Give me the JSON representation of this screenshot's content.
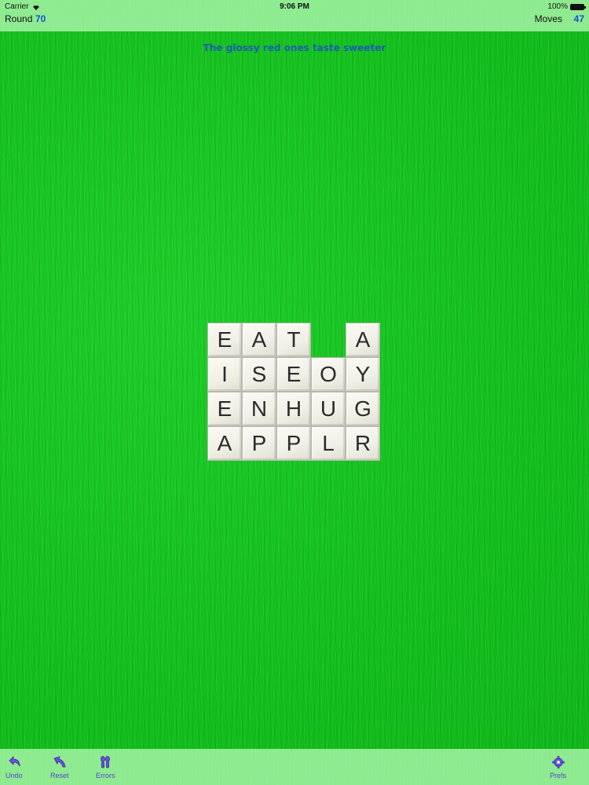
{
  "status_bar": {
    "carrier": "Carrier",
    "time": "9:06 PM",
    "battery": "100%"
  },
  "header": {
    "round_label": "Round",
    "round_value": "70",
    "moves_label": "Moves",
    "moves_value": "47"
  },
  "hint": "The glossy red ones taste sweeter",
  "board": {
    "rows": [
      [
        "E",
        "A",
        "T",
        "",
        "A"
      ],
      [
        "I",
        "S",
        "E",
        "O",
        "Y"
      ],
      [
        "E",
        "N",
        "H",
        "U",
        "G"
      ],
      [
        "A",
        "P",
        "P",
        "L",
        "R"
      ]
    ]
  },
  "toolbar": {
    "undo_label": "Undo",
    "reset_label": "Reset",
    "errors_label": "Errors",
    "prefs_label": "Prefs"
  },
  "colors": {
    "background": "#14c21e",
    "bar": "#aaf5aa",
    "accent_blue": "#1a4fd6",
    "toolbar_purple": "#5a3fcf"
  },
  "icons": [
    "wifi-icon",
    "battery-icon",
    "undo-icon",
    "reset-icon",
    "errors-icon",
    "prefs-gear-icon"
  ]
}
